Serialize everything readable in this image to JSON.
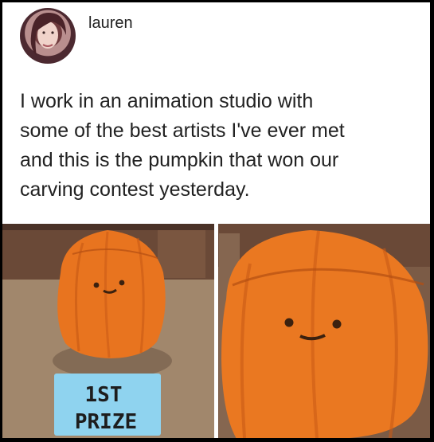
{
  "post": {
    "username": "lauren",
    "text": "I work in an animation studio with\nsome of the best artists I've ever met\nand this is the pumpkin that won our\ncarving contest yesterday."
  },
  "photos": {
    "prize_card": {
      "line1": "1ST",
      "line2": "PRIZE"
    }
  },
  "colors": {
    "pumpkin": "#e8741f",
    "prize_card": "#8fd3ef"
  }
}
